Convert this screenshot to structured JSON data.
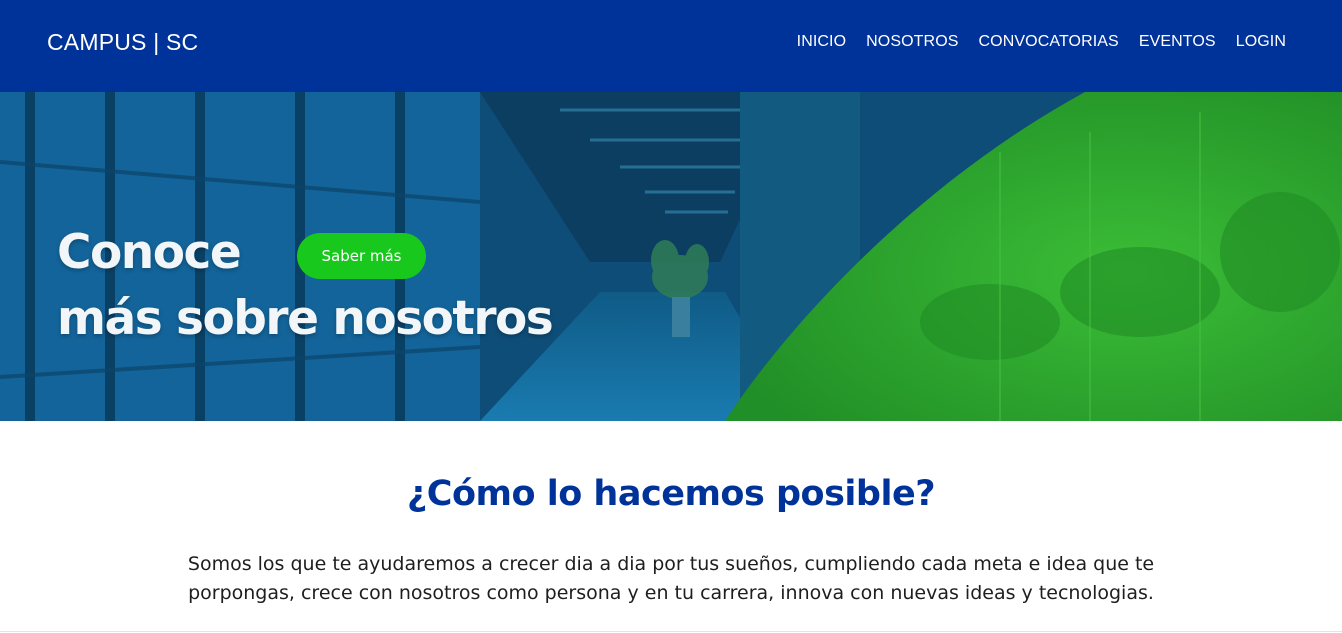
{
  "navbar": {
    "brand": "CAMPUS | SC",
    "links": [
      "INICIO",
      "NOSOTROS",
      "CONVOCATORIAS",
      "EVENTOS",
      "LOGIN"
    ]
  },
  "hero": {
    "title_line1": "Conoce",
    "title_line2": "más sobre nosotros",
    "cta_label": "Saber más"
  },
  "section": {
    "title": "¿Cómo lo hacemos posible?",
    "text": "Somos los que te ayudaremos a crecer dia a dia por tus sueños, cumpliendo cada meta e idea que te porpongas, crece con nosotros como persona y en tu carrera, innova con nuevas ideas y tecnologias."
  },
  "colors": {
    "primary": "#003399",
    "accent_green": "#18c81d",
    "hero_green": "#2aa12a"
  }
}
